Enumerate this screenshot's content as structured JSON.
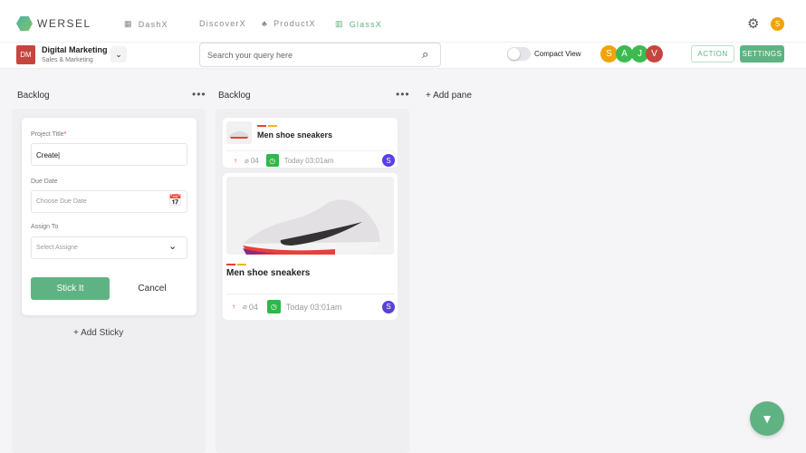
{
  "app": {
    "brand": "WERSEL"
  },
  "nav": [
    {
      "label": "DashX"
    },
    {
      "label": "DiscoverX"
    },
    {
      "label": "ProductX"
    },
    {
      "label": "GlassX"
    }
  ],
  "user_avatar": "S",
  "workspace": {
    "initials": "DM",
    "name": "Digital Marketing",
    "subtitle": "Sales & Marketing"
  },
  "search": {
    "placeholder": "Search your query here"
  },
  "compact_view": {
    "label": "Compact View",
    "on": false
  },
  "members": [
    {
      "initial": "S",
      "color": "#f0a30a"
    },
    {
      "initial": "A",
      "color": "#3cba4f"
    },
    {
      "initial": "J",
      "color": "#3cba4f"
    },
    {
      "initial": "V",
      "color": "#c5463f"
    }
  ],
  "actions": {
    "action": "ACTION",
    "settings": "SETTINGS"
  },
  "columns": [
    {
      "title": "Backlog",
      "form": {
        "title_label": "Project Title",
        "required": "*",
        "title_value": "Create",
        "due_label": "Due Date",
        "due_placeholder": "Choose Due Date",
        "assign_label": "Assign To",
        "assign_placeholder": "Select Assigne",
        "submit": "Stick It",
        "cancel": "Cancel"
      },
      "add_sticky": "+ Add Sticky"
    },
    {
      "title": "Backlog",
      "cards": [
        {
          "title": "Men shoe sneakers",
          "attachments": "04",
          "time": "Today 03:01am",
          "assignee": "S"
        },
        {
          "title": "Men shoe sneakers",
          "attachments": "04",
          "time": "Today 03:01am",
          "assignee": "S"
        }
      ]
    }
  ],
  "add_pane": "+ Add pane",
  "colors": {
    "accent": "#5fb382",
    "tag1": "#e8403c",
    "tag2": "#f0b429",
    "assignee": "#5b3fe0"
  }
}
